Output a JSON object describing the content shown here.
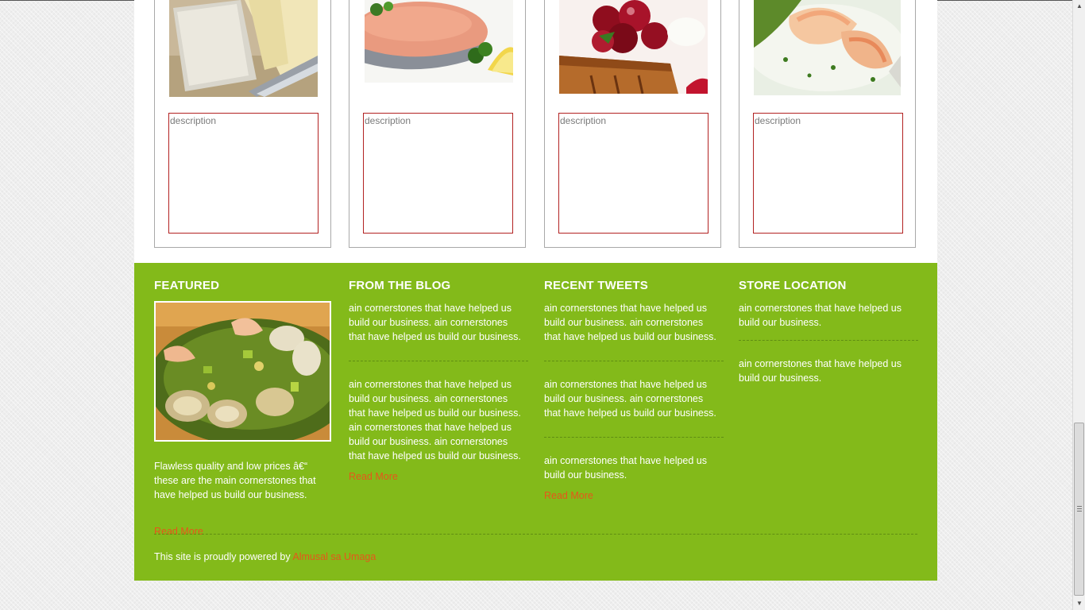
{
  "products": [
    {
      "image_icon": "cheese-photo",
      "description_placeholder": "description"
    },
    {
      "image_icon": "salmon-photo",
      "description_placeholder": "description"
    },
    {
      "image_icon": "cherry-dessert-photo",
      "description_placeholder": "description"
    },
    {
      "image_icon": "shrimp-photo",
      "description_placeholder": "description"
    }
  ],
  "footer": {
    "featured": {
      "title": "FEATURED",
      "image_icon": "seafood-salad-photo",
      "text": "Flawless quality and low prices â€“ these are the main cornerstones that have helped us build our business.",
      "read_more": "Read More"
    },
    "blog": {
      "title": "FROM THE BLOG",
      "posts": [
        "ain cornerstones that have helped us build our business. ain cornerstones that have helped us build our business.",
        "ain cornerstones that have helped us build our business. ain cornerstones that have helped us build our business. ain cornerstones that have helped us build our business. ain cornerstones that have helped us build our business."
      ],
      "read_more": "Read More"
    },
    "tweets": {
      "title": "RECENT TWEETS",
      "items": [
        "ain cornerstones that have helped us build our business. ain cornerstones that have helped us build our business.",
        "ain cornerstones that have helped us build our business. ain cornerstones that have helped us build our business.",
        "ain cornerstones that have helped us build our business."
      ],
      "read_more": "Read More"
    },
    "store": {
      "title": "STORE LOCATION",
      "items": [
        "ain cornerstones that have helped us build our business.",
        "ain cornerstones that have helped us build our business."
      ]
    },
    "powered_prefix": "This site is proudly powered by",
    "powered_link": "Almusal sa Umaga"
  },
  "colors": {
    "footer_green": "#83ba1a",
    "link_orange": "#e6561a",
    "description_border": "#b22222"
  }
}
